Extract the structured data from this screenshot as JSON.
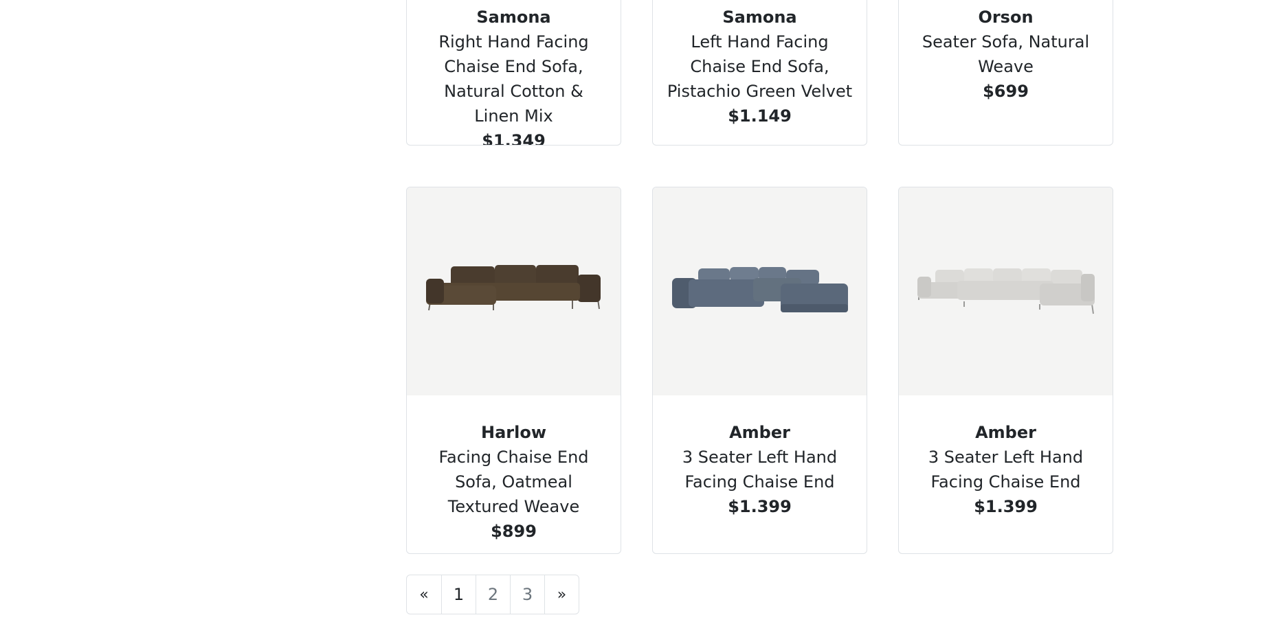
{
  "products_top": [
    {
      "brand": "Samona",
      "desc": "Right Hand Facing Chaise End Sofa, Natural Cotton & Linen Mix",
      "price": "$1.349"
    },
    {
      "brand": "Samona",
      "desc": "Left Hand Facing Chaise End Sofa, Pistachio Green Velvet",
      "price": "$1.149"
    },
    {
      "brand": "Orson",
      "desc": "Seater Sofa, Natural Weave",
      "price": "$699"
    }
  ],
  "products_bottom": [
    {
      "brand": "Harlow",
      "desc": "Facing Chaise End Sofa, Oatmeal Textured Weave",
      "price": "$899",
      "image": "brown-chaise-sofa-image",
      "color": "#4a3c2e"
    },
    {
      "brand": "Amber",
      "desc": "3 Seater Left Hand Facing Chaise End",
      "price": "$1.399",
      "image": "blue-corner-sofa-image",
      "color": "#5d6b7e"
    },
    {
      "brand": "Amber",
      "desc": "3 Seater Left Hand Facing Chaise End",
      "price": "$1.399",
      "image": "grey-u-shaped-sofa-image",
      "color": "#d3d2cf"
    }
  ],
  "pagination": {
    "prev": "«",
    "pages": [
      "1",
      "2",
      "3"
    ],
    "next": "»",
    "current": "1"
  }
}
